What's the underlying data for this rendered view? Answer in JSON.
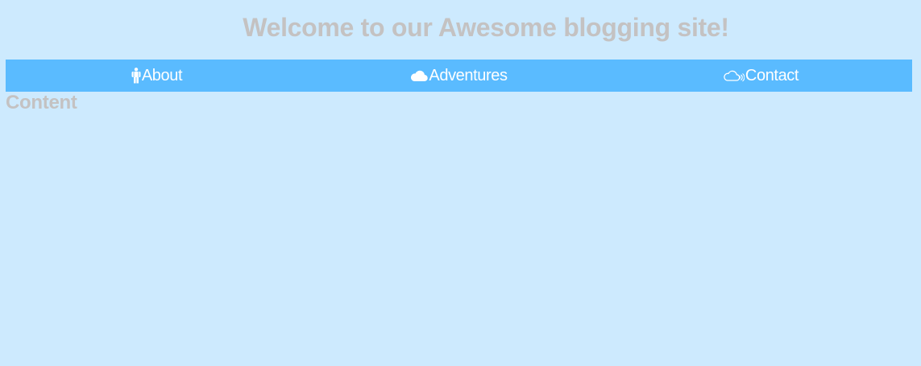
{
  "header": {
    "title": "Welcome to our Awesome blogging site!"
  },
  "nav": {
    "items": [
      {
        "label": "About",
        "icon": "person-icon"
      },
      {
        "label": "Adventures",
        "icon": "cloud-icon"
      },
      {
        "label": "Contact",
        "icon": "cloud-signal-icon"
      }
    ]
  },
  "main": {
    "heading": "Content"
  },
  "colors": {
    "background": "#cdeafe",
    "nav_background": "#5abbff",
    "heading_text": "#c4c2c2",
    "nav_text": "#ffffff"
  }
}
